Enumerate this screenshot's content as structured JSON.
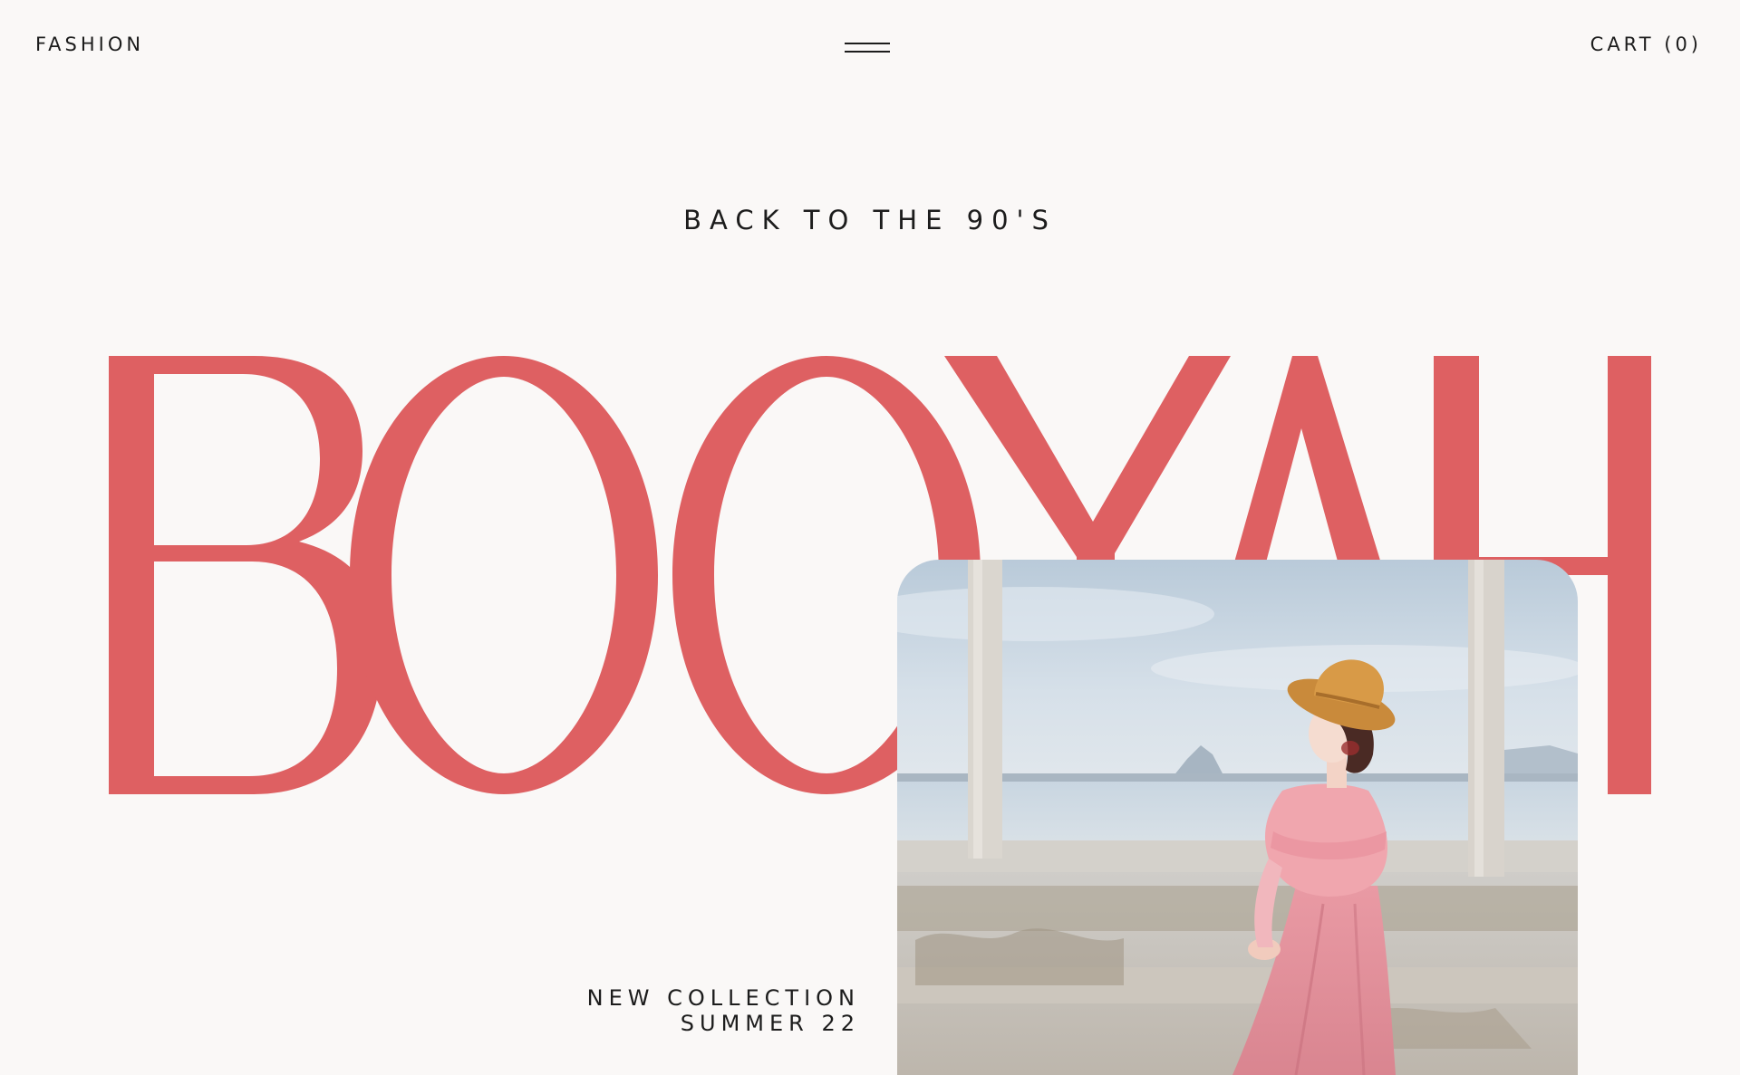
{
  "nav": {
    "logo": "FASHION",
    "menu_icon": "hamburger-menu-icon",
    "cart_label": "CART (0)"
  },
  "hero": {
    "tagline": "BACK TO THE 90'S",
    "headline": "BOOYAH",
    "headline_color": "#de6062",
    "collection_line1": "NEW COLLECTION",
    "collection_line2": "SUMMER 22"
  },
  "colors": {
    "background": "#faf8f7",
    "text": "#1c1c1c",
    "accent": "#de6062"
  }
}
